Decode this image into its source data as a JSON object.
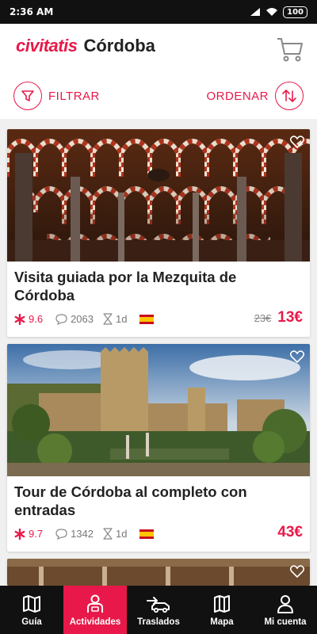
{
  "status": {
    "time": "2:36 AM",
    "battery": "100"
  },
  "header": {
    "logo": "civitatis",
    "city": "Córdoba"
  },
  "actions": {
    "filter_label": "FILTRAR",
    "order_label": "ORDENAR"
  },
  "cards": [
    {
      "title": "Visita guiada por la Mezquita de Córdoba",
      "rating": "9.6",
      "reviews": "2063",
      "duration": "1d",
      "old_price": "23€",
      "price": "13€"
    },
    {
      "title": "Tour de Córdoba al completo con entradas",
      "rating": "9.7",
      "reviews": "1342",
      "duration": "1d",
      "old_price": "",
      "price": "43€"
    }
  ],
  "tabs": [
    {
      "label": "Guía",
      "icon": "map-book-icon"
    },
    {
      "label": "Actividades",
      "icon": "person-icon"
    },
    {
      "label": "Traslados",
      "icon": "car-transfer-icon"
    },
    {
      "label": "Mapa",
      "icon": "map-icon"
    },
    {
      "label": "Mi cuenta",
      "icon": "account-icon"
    }
  ],
  "colors": {
    "brand": "#e8194a",
    "tabbar": "#111111"
  }
}
